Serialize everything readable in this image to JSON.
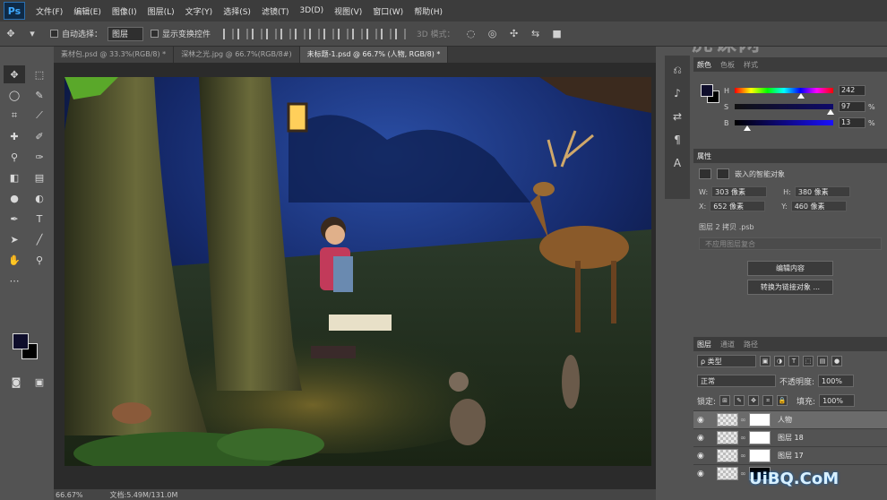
{
  "app": {
    "logo": "Ps",
    "menu": [
      "文件(F)",
      "编辑(E)",
      "图像(I)",
      "图层(L)",
      "文字(Y)",
      "选择(S)",
      "滤镜(T)",
      "3D(D)",
      "视图(V)",
      "窗口(W)",
      "帮助(H)"
    ]
  },
  "options": {
    "auto_select_label": "自动选择：",
    "auto_select_value": "图层",
    "show_transform_label": "显示变换控件",
    "mode_3d": "3D 模式："
  },
  "tabs": [
    {
      "label": "素材包.psd @ 33.3%(RGB/8) *"
    },
    {
      "label": "深林之光.jpg @ 66.7%(RGB/8#)"
    },
    {
      "label": "未标题-1.psd @ 66.7% (人物, RGB/8) *"
    }
  ],
  "status": {
    "zoom": "66.67%",
    "doc": "文档:5.49M/131.0M"
  },
  "color_panel": {
    "tabs": [
      "颜色",
      "色板",
      "样式"
    ],
    "h_label": "H",
    "h_value": "242",
    "s_label": "S",
    "s_value": "97",
    "b_label": "B",
    "b_value": "13",
    "percent": "%",
    "h_fraction": 0.67,
    "s_fraction": 0.97,
    "b_fraction": 0.13
  },
  "props_panel": {
    "title": "属性",
    "type": "嵌入的智能对象",
    "w_label": "W:",
    "w_value": "303 像素",
    "h_label": "H:",
    "h_value": "380 像素",
    "x_label": "X:",
    "x_value": "652 像素",
    "y_label": "Y:",
    "y_value": "460 像素",
    "file": "图层 2 拷贝 .psb",
    "comp": "不应用图层复合",
    "edit_btn": "编辑内容",
    "convert_btn": "转换为链接对象 ..."
  },
  "layers_panel": {
    "tabs": [
      "图层",
      "通道",
      "路径"
    ],
    "filter": "ρ 类型",
    "blend": "正常",
    "opacity_label": "不透明度:",
    "opacity_value": "100%",
    "lock_label": "锁定:",
    "fill_label": "填充:",
    "fill_value": "100%",
    "layers": [
      {
        "name": "人物",
        "selected": true
      },
      {
        "name": "图层 18",
        "selected": false
      },
      {
        "name": "图层 17",
        "selected": false
      },
      {
        "name": "",
        "selected": false
      }
    ]
  },
  "watermark": {
    "top": "虎课网",
    "bottom": "UiBQ.CoM"
  }
}
